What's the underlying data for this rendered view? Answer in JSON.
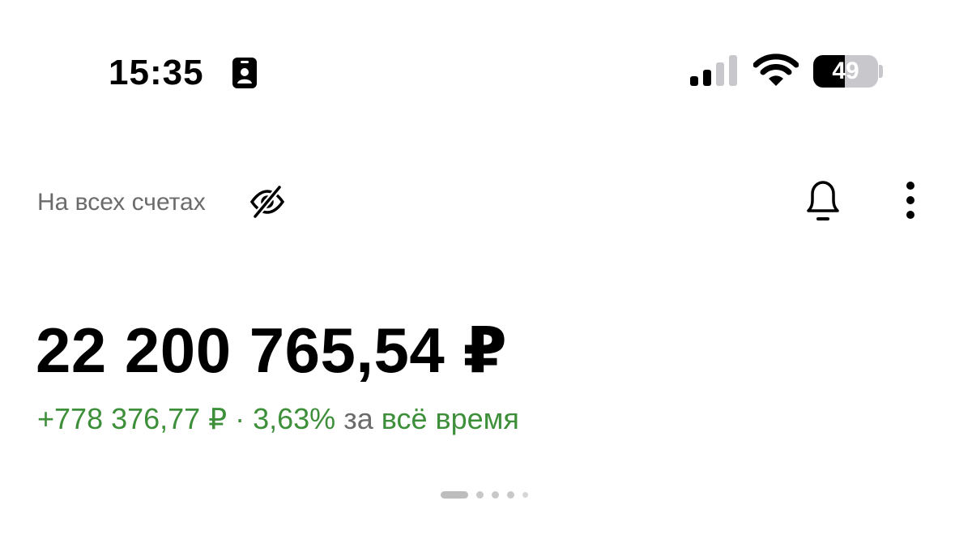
{
  "status_bar": {
    "time": "15:35",
    "battery_level": "49",
    "battery_fraction": 0.49,
    "signal_bars_active": 2,
    "signal_bars_total": 4
  },
  "header": {
    "accounts_label": "На всех счетах",
    "icons": [
      "eye-off-icon",
      "bell-icon",
      "more-vertical-icon"
    ]
  },
  "balance": {
    "amount": "22 200 765,54 ₽",
    "change_amount": "+778 376,77 ₽",
    "separator": " · ",
    "change_percent": "3,63%",
    "period_prefix": " за ",
    "period": "всё время"
  },
  "pager": {
    "pages": 5,
    "active_index": 0
  },
  "colors": {
    "positive": "#3d8f3a",
    "secondary_text": "#6b6b6b",
    "primary_text": "#000000",
    "background": "#ffffff"
  }
}
